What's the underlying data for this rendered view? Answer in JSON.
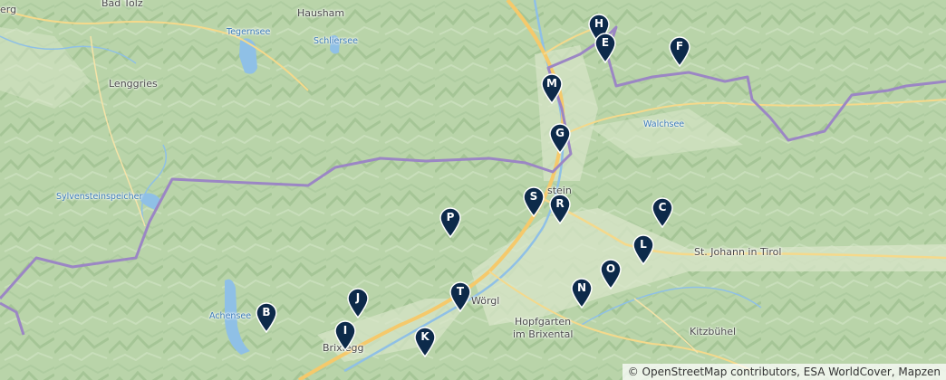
{
  "map": {
    "places": [
      {
        "id": "bad-tolz",
        "label": "Bad Tölz"
      },
      {
        "id": "hausham",
        "label": "Hausham"
      },
      {
        "id": "tegernsee",
        "label": "Tegernsee"
      },
      {
        "id": "schliersee",
        "label": "Schliersee"
      },
      {
        "id": "lenggries",
        "label": "Lenggries"
      },
      {
        "id": "walchsee",
        "label": "Walchsee"
      },
      {
        "id": "sylvensteinspeicher",
        "label": "Sylvensteinspeicher"
      },
      {
        "id": "kufstein",
        "label": "stein"
      },
      {
        "id": "st-johann",
        "label": "St. Johann in Tirol"
      },
      {
        "id": "worgl",
        "label": "Wörgl"
      },
      {
        "id": "achensee",
        "label": "Achensee"
      },
      {
        "id": "hopfgarten-1",
        "label": "Hopfgarten"
      },
      {
        "id": "hopfgarten-2",
        "label": "im Brixental"
      },
      {
        "id": "kitzbuhel",
        "label": "Kitzbühel"
      },
      {
        "id": "brixlegg",
        "label": "Brixlegg"
      },
      {
        "id": "berg",
        "label": "erg"
      }
    ],
    "markers": [
      "H",
      "E",
      "F",
      "M",
      "G",
      "S",
      "R",
      "C",
      "L",
      "O",
      "N",
      "P",
      "T",
      "J",
      "B",
      "I",
      "K"
    ],
    "attribution": "© OpenStreetMap contributors, ESA WorldCover, Mapzen",
    "colors": {
      "marker": "#0d2a4a",
      "border": "#9b86c4",
      "road_major": "#f5c96b",
      "water": "#8fc0e6",
      "terrain": "#b8d3a8"
    }
  }
}
